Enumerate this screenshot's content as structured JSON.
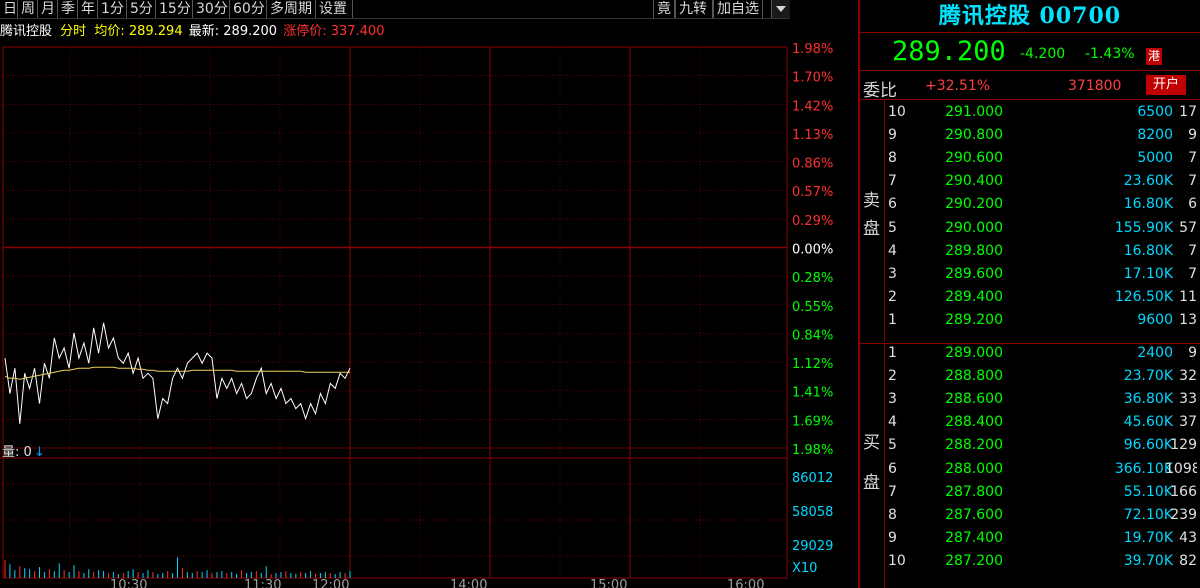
{
  "toolbar": {
    "left_buttons": [
      "日",
      "周",
      "月",
      "季",
      "年",
      "1分",
      "5分",
      "15分",
      "30分",
      "60分",
      "多周期",
      "设置"
    ],
    "right_buttons": [
      "竟",
      "九转",
      "加自选"
    ]
  },
  "info": {
    "name": "腾讯控股",
    "mode": "分时",
    "avg_label": "均价:",
    "avg_value": "289.294",
    "last_label": "最新:",
    "last_value": "289.200",
    "limit_label": "涨停价:",
    "limit_value": "337.400"
  },
  "chart_data": {
    "type": "line",
    "price_axis_right": [
      "1.98%",
      "1.70%",
      "1.42%",
      "1.13%",
      "0.86%",
      "0.57%",
      "0.29%",
      "0.00%",
      "0.28%",
      "0.55%",
      "0.84%",
      "1.12%",
      "1.41%",
      "1.69%",
      "1.98%"
    ],
    "volume_axis_right": [
      "86012",
      "58058",
      "29029",
      "X10"
    ],
    "x_ticks": [
      "10:30",
      "11:30",
      "12:00",
      "14:00",
      "15:00",
      "16:00"
    ],
    "volume_label": "量: 0",
    "volume_arrow": "↓",
    "series": [
      {
        "color": "#ffffff",
        "values": [
          -1.1,
          -1.45,
          -1.2,
          -1.75,
          -1.25,
          -1.4,
          -1.2,
          -1.55,
          -1.15,
          -1.3,
          -0.9,
          -1.1,
          -1.0,
          -1.2,
          -0.85,
          -1.1,
          -0.95,
          -1.15,
          -0.8,
          -1.05,
          -0.75,
          -1.0,
          -0.9,
          -1.1,
          -1.15,
          -1.05,
          -1.25,
          -1.1,
          -1.3,
          -1.25,
          -1.3,
          -1.7,
          -1.5,
          -1.55,
          -1.3,
          -1.2,
          -1.3,
          -1.15,
          -1.1,
          -1.05,
          -1.15,
          -1.05,
          -1.1,
          -1.5,
          -1.3,
          -1.4,
          -1.3,
          -1.45,
          -1.35,
          -1.5,
          -1.45,
          -1.3,
          -1.2,
          -1.45,
          -1.35,
          -1.5,
          -1.4,
          -1.55,
          -1.5,
          -1.6,
          -1.55,
          -1.7,
          -1.55,
          -1.65,
          -1.45,
          -1.55,
          -1.35,
          -1.4,
          -1.25,
          -1.3,
          -1.2
        ]
      },
      {
        "color": "#f0d060",
        "values": [
          -1.28,
          -1.3,
          -1.3,
          -1.31,
          -1.3,
          -1.29,
          -1.28,
          -1.27,
          -1.26,
          -1.25,
          -1.24,
          -1.23,
          -1.22,
          -1.22,
          -1.21,
          -1.2,
          -1.2,
          -1.2,
          -1.19,
          -1.19,
          -1.19,
          -1.19,
          -1.19,
          -1.2,
          -1.2,
          -1.2,
          -1.2,
          -1.21,
          -1.21,
          -1.22,
          -1.22,
          -1.23,
          -1.23,
          -1.23,
          -1.23,
          -1.23,
          -1.23,
          -1.23,
          -1.22,
          -1.22,
          -1.22,
          -1.22,
          -1.22,
          -1.22,
          -1.22,
          -1.22,
          -1.22,
          -1.23,
          -1.23,
          -1.23,
          -1.23,
          -1.23,
          -1.23,
          -1.23,
          -1.23,
          -1.23,
          -1.23,
          -1.23,
          -1.23,
          -1.23,
          -1.23,
          -1.24,
          -1.24,
          -1.24,
          -1.24,
          -1.24,
          -1.24,
          -1.24,
          -1.24,
          -1.24,
          -1.24
        ]
      }
    ],
    "volume": [
      1800,
      1400,
      800,
      1200,
      1000,
      900,
      700,
      1100,
      600,
      900,
      700,
      1500,
      800,
      600,
      1300,
      700,
      500,
      900,
      600,
      800,
      700,
      500,
      600,
      400,
      500,
      700,
      900,
      600,
      500,
      800,
      600,
      400,
      500,
      700,
      500,
      2100,
      1000,
      600,
      500,
      700,
      600,
      800,
      500,
      600,
      700,
      500,
      600,
      400,
      800,
      500,
      600,
      700,
      500,
      1200,
      400,
      500,
      600,
      700,
      500,
      400,
      600,
      500,
      700,
      400,
      500,
      600,
      500,
      400,
      600,
      500,
      700
    ],
    "y_range": [
      -1.98,
      1.98
    ],
    "volume_max": 86012,
    "grid": true
  },
  "quote": {
    "title": "腾讯控股 00700",
    "last": "289.200",
    "change": "-4.200",
    "change_pct": "-1.43%",
    "market_badge": "港",
    "weibi_label": "委比",
    "weibi_value": "+32.51%",
    "weicha_value": "371800",
    "open_button": "开户",
    "sell_label": [
      "卖",
      "盘"
    ],
    "buy_label": [
      "买",
      "盘"
    ],
    "asks": [
      {
        "lvl": "10",
        "price": "291.000",
        "vol": "6500",
        "cnt": "17"
      },
      {
        "lvl": "9",
        "price": "290.800",
        "vol": "8200",
        "cnt": "9"
      },
      {
        "lvl": "8",
        "price": "290.600",
        "vol": "5000",
        "cnt": "7"
      },
      {
        "lvl": "7",
        "price": "290.400",
        "vol": "23.60K",
        "cnt": "7"
      },
      {
        "lvl": "6",
        "price": "290.200",
        "vol": "16.80K",
        "cnt": "6"
      },
      {
        "lvl": "5",
        "price": "290.000",
        "vol": "155.90K",
        "cnt": "57"
      },
      {
        "lvl": "4",
        "price": "289.800",
        "vol": "16.80K",
        "cnt": "7"
      },
      {
        "lvl": "3",
        "price": "289.600",
        "vol": "17.10K",
        "cnt": "7"
      },
      {
        "lvl": "2",
        "price": "289.400",
        "vol": "126.50K",
        "cnt": "11"
      },
      {
        "lvl": "1",
        "price": "289.200",
        "vol": "9600",
        "cnt": "13"
      }
    ],
    "bids": [
      {
        "lvl": "1",
        "price": "289.000",
        "vol": "2400",
        "cnt": "9"
      },
      {
        "lvl": "2",
        "price": "288.800",
        "vol": "23.70K",
        "cnt": "32"
      },
      {
        "lvl": "3",
        "price": "288.600",
        "vol": "36.80K",
        "cnt": "33"
      },
      {
        "lvl": "4",
        "price": "288.400",
        "vol": "45.60K",
        "cnt": "37"
      },
      {
        "lvl": "5",
        "price": "288.200",
        "vol": "96.60K",
        "cnt": "129"
      },
      {
        "lvl": "6",
        "price": "288.000",
        "vol": "366.10K",
        "cnt": "1098"
      },
      {
        "lvl": "7",
        "price": "287.800",
        "vol": "55.10K",
        "cnt": "166"
      },
      {
        "lvl": "8",
        "price": "287.600",
        "vol": "72.10K",
        "cnt": "239"
      },
      {
        "lvl": "9",
        "price": "287.400",
        "vol": "19.70K",
        "cnt": "43"
      },
      {
        "lvl": "10",
        "price": "287.200",
        "vol": "39.70K",
        "cnt": "82"
      }
    ]
  }
}
